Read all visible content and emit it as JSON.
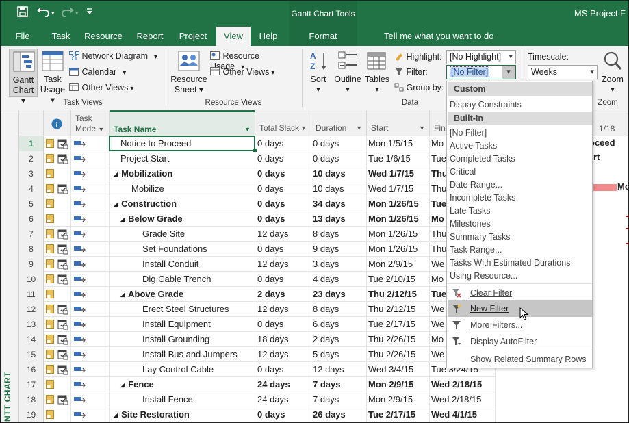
{
  "window": {
    "app_title": "MS Project F",
    "context_title": "Gantt Chart Tools"
  },
  "tabs": [
    {
      "label": "File"
    },
    {
      "label": "Task"
    },
    {
      "label": "Resource"
    },
    {
      "label": "Report"
    },
    {
      "label": "Project"
    },
    {
      "label": "View"
    },
    {
      "label": "Help"
    },
    {
      "label": "Format"
    }
  ],
  "tell_me": "Tell me what you want to do",
  "ribbon": {
    "task_views": {
      "label": "Task Views",
      "gantt_chart": [
        "Gantt",
        "Chart"
      ],
      "task_usage": [
        "Task",
        "Usage"
      ],
      "network_diagram": "Network Diagram",
      "calendar": "Calendar",
      "other_views": "Other Views"
    },
    "resource_views": {
      "label": "Resource Views",
      "resource_sheet": [
        "Resource",
        "Sheet"
      ],
      "resource_usage": "Resource Usage",
      "other_views": "Other Views"
    },
    "data": {
      "label": "Data",
      "sort": "Sort",
      "outline": "Outline",
      "tables": "Tables",
      "highlight_label": "Highlight:",
      "highlight_value": "[No Highlight]",
      "filter_label": "Filter:",
      "filter_value": "[No Filter]",
      "group_by_label": "Group by:"
    },
    "zoom": {
      "label": "Zoom",
      "timescale_label": "Timescale:",
      "timescale_value": "Weeks",
      "zoom_button": "Zoom"
    }
  },
  "grid": {
    "headers": {
      "info": "i",
      "task_mode": [
        "Task",
        "Mode"
      ],
      "task_name": "Task Name",
      "total_slack": "Total Slack",
      "duration": "Duration",
      "start": "Start",
      "finish": "Fini"
    },
    "rows": [
      {
        "id": "1",
        "name": "Notice to Proceed",
        "slack": "0 days",
        "duration": "0 days",
        "start": "Mon 1/5/15",
        "finish": "Mo",
        "level": 1,
        "summary": false,
        "prefix": ""
      },
      {
        "id": "2",
        "name": "Project Start",
        "slack": "0 days",
        "duration": "0 days",
        "start": "Tue 1/6/15",
        "finish": "Tue",
        "level": 1,
        "summary": false,
        "prefix": ""
      },
      {
        "id": "3",
        "name": "Mobilization",
        "slack": "0 days",
        "duration": "10 days",
        "start": "Wed 1/7/15",
        "finish": "Thu",
        "level": 0,
        "summary": true,
        "prefix": "◢"
      },
      {
        "id": "4",
        "name": "Mobilize",
        "slack": "0 days",
        "duration": "10 days",
        "start": "Wed 1/7/15",
        "finish": "Thu",
        "level": 2,
        "summary": false,
        "prefix": ""
      },
      {
        "id": "5",
        "name": "Construction",
        "slack": "0 days",
        "duration": "34 days",
        "start": "Mon 1/26/15",
        "finish": "Tue",
        "level": 0,
        "summary": true,
        "prefix": "◢"
      },
      {
        "id": "6",
        "name": "Below Grade",
        "slack": "0 days",
        "duration": "13 days",
        "start": "Mon 1/26/15",
        "finish": "Mo",
        "level": 1,
        "summary": true,
        "prefix": "◢"
      },
      {
        "id": "7",
        "name": "Grade Site",
        "slack": "12 days",
        "duration": "8 days",
        "start": "Mon 1/26/15",
        "finish": "Thu",
        "level": 3,
        "summary": false,
        "prefix": ""
      },
      {
        "id": "8",
        "name": "Set Foundations",
        "slack": "0 days",
        "duration": "9 days",
        "start": "Mon 1/26/15",
        "finish": "Thu",
        "level": 3,
        "summary": false,
        "prefix": ""
      },
      {
        "id": "9",
        "name": "Install Conduit",
        "slack": "12 days",
        "duration": "3 days",
        "start": "Mon 2/9/15",
        "finish": "We",
        "level": 3,
        "summary": false,
        "prefix": ""
      },
      {
        "id": "10",
        "name": "Dig Cable Trench",
        "slack": "0 days",
        "duration": "4 days",
        "start": "Tue 2/10/15",
        "finish": "Mo",
        "level": 3,
        "summary": false,
        "prefix": ""
      },
      {
        "id": "11",
        "name": "Above Grade",
        "slack": "2 days",
        "duration": "23 days",
        "start": "Thu 2/12/15",
        "finish": "Tue",
        "level": 1,
        "summary": true,
        "prefix": "◢"
      },
      {
        "id": "12",
        "name": "Erect Steel Structures",
        "slack": "12 days",
        "duration": "8 days",
        "start": "Thu 2/12/15",
        "finish": "We",
        "level": 3,
        "summary": false,
        "prefix": ""
      },
      {
        "id": "13",
        "name": "Install Equipment",
        "slack": "0 days",
        "duration": "6 days",
        "start": "Tue 2/17/15",
        "finish": "We",
        "level": 3,
        "summary": false,
        "prefix": ""
      },
      {
        "id": "14",
        "name": "Install Grounding",
        "slack": "18 days",
        "duration": "2 days",
        "start": "Thu 2/26/15",
        "finish": "Mo",
        "level": 3,
        "summary": false,
        "prefix": ""
      },
      {
        "id": "15",
        "name": "Install Bus and Jumpers",
        "slack": "12 days",
        "duration": "5 days",
        "start": "Thu 2/26/15",
        "finish": "We",
        "level": 3,
        "summary": false,
        "prefix": ""
      },
      {
        "id": "16",
        "name": "Lay Control Cable",
        "slack": "0 days",
        "duration": "12 days",
        "start": "Wed 3/4/15",
        "finish": "Tue 3/24/15",
        "level": 3,
        "summary": false,
        "prefix": ""
      },
      {
        "id": "17",
        "name": "Fence",
        "slack": "24 days",
        "duration": "7 days",
        "start": "Mon 2/9/15",
        "finish": "Wed 2/18/15",
        "level": 1,
        "summary": true,
        "prefix": "◢"
      },
      {
        "id": "18",
        "name": "Install Fence",
        "slack": "24 days",
        "duration": "7 days",
        "start": "Mon 2/9/15",
        "finish": "Wed 2/18/15",
        "level": 3,
        "summary": false,
        "prefix": ""
      },
      {
        "id": "19",
        "name": "Site Restoration",
        "slack": "0 days",
        "duration": "26 days",
        "start": "Tue 2/17/15",
        "finish": "Wed 4/1/15",
        "level": 0,
        "summary": true,
        "prefix": "◢"
      }
    ]
  },
  "side_label": "NTT CHART",
  "gantt": {
    "date_label": "1/18",
    "label_proceed": "oceed",
    "label_start": "rt",
    "label_mo": "Mo"
  },
  "filter_menu": {
    "custom_header": "Custom",
    "custom_items": [
      "Dispay Constraints"
    ],
    "builtin_header": "Built-In",
    "builtin_items": [
      "[No Filter]",
      "Active Tasks",
      "Completed Tasks",
      "Critical",
      "Date Range...",
      "Incomplete Tasks",
      "Late Tasks",
      "Milestones",
      "Summary Tasks",
      "Task Range...",
      "Tasks With Estimated Durations",
      "Using Resource..."
    ],
    "actions": {
      "clear": "Clear Filter",
      "new": "New Filter",
      "more": "More Filters...",
      "auto": "Display AutoFilter",
      "related": "Show Related Summary Rows"
    }
  },
  "colors": {
    "brand": "#217346",
    "critical_bar": "#f28b8b",
    "icon_yellow": "#e8c15a",
    "icon_blue": "#3b6fb6"
  }
}
